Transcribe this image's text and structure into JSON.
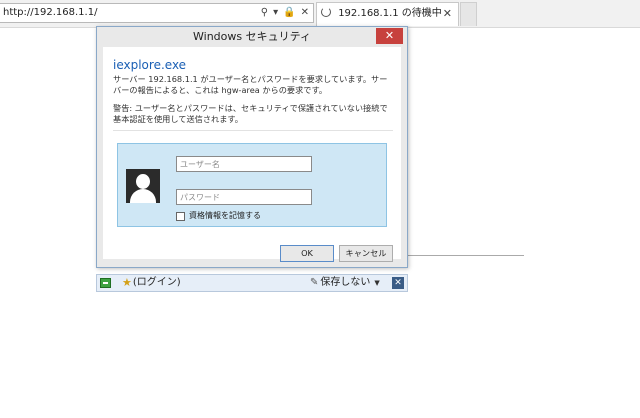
{
  "browser": {
    "address": "http://192.168.1.1/",
    "tab_title": "192.168.1.1 の待機中",
    "icons": [
      "search-icon",
      "refresh-icon",
      "lock-icon",
      "chevron-down-icon",
      "close-icon",
      "loading-spinner-icon"
    ]
  },
  "dialog": {
    "title": "Windows セキュリティ",
    "close_label": "✕",
    "app_name": "iexplore.exe",
    "message1": "サーバー 192.168.1.1 がユーザー名とパスワードを要求しています。サーバーの報告によると、これは hgw-area からの要求です。",
    "message2": "警告: ユーザー名とパスワードは、セキュリティで保護されていない接続で基本認証を使用して送信されます。",
    "username_placeholder": "ユーザー名",
    "password_placeholder": "パスワード",
    "remember_label": "資格情報を記憶する",
    "ok_label": "OK",
    "cancel_label": "キャンセル"
  },
  "infobar": {
    "login_label": "(ログイン)",
    "save_label": "保存しない",
    "close_label": "✕"
  }
}
